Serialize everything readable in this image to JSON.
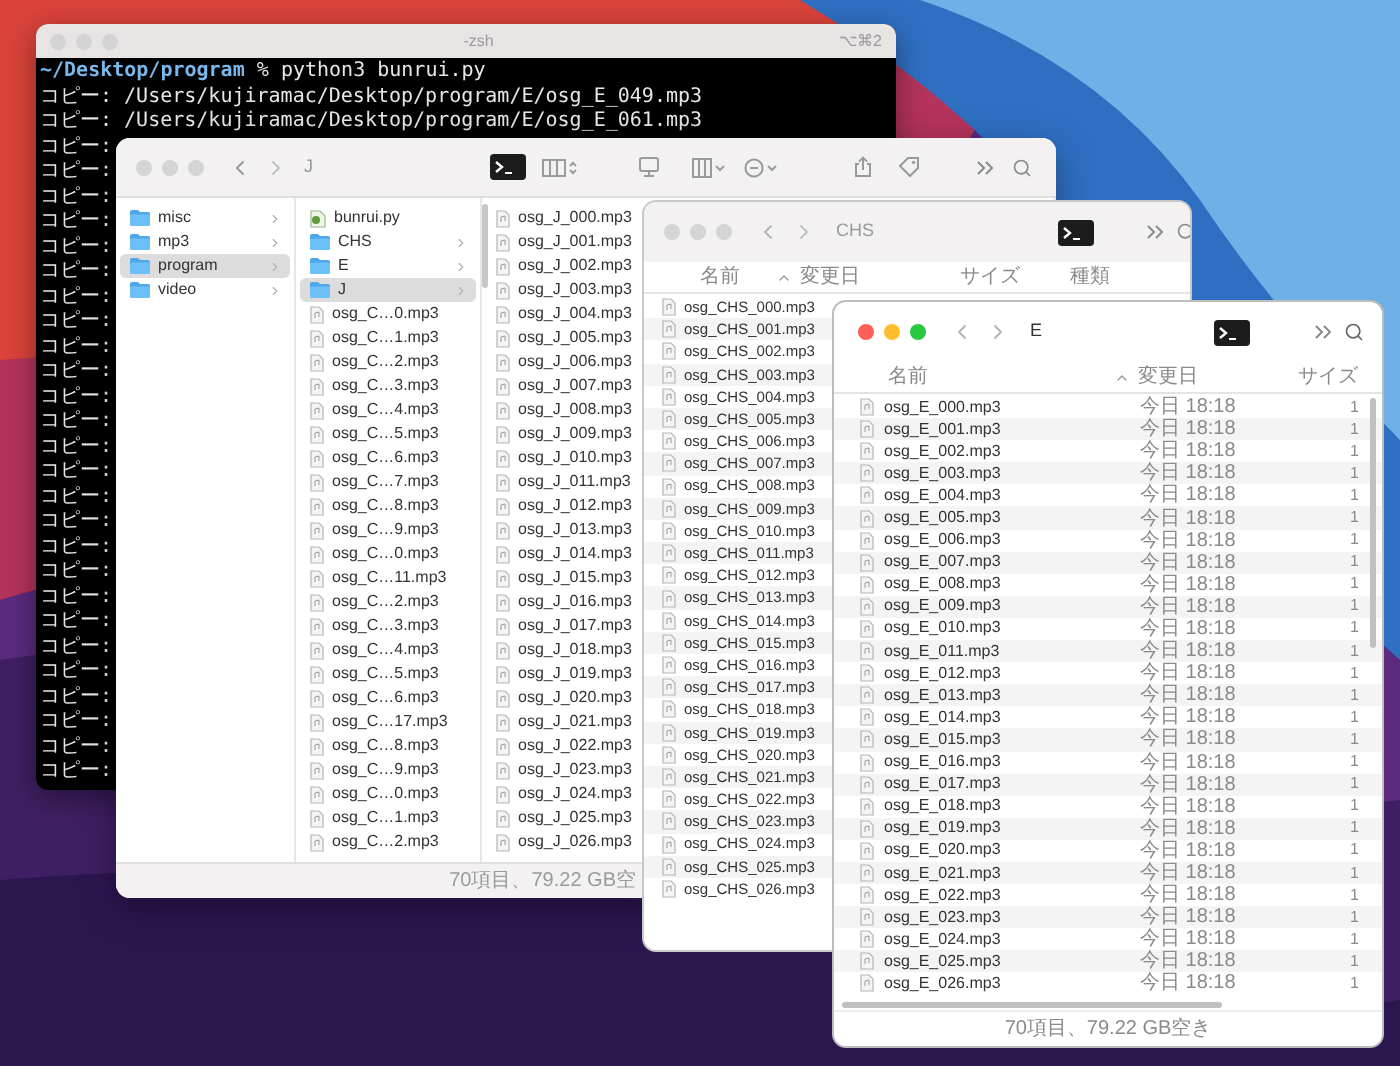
{
  "terminal": {
    "active": false,
    "title": "-zsh",
    "shortcut": "⌥⌘2",
    "prompt": {
      "path": "~/Desktop/program",
      "symbol": "%",
      "command": "python3 bunrui.py"
    },
    "lines": [
      "コピー: /Users/kujiramac/Desktop/program/E/osg_E_049.mp3",
      "コピー: /Users/kujiramac/Desktop/program/E/osg_E_061.mp3",
      "コピー:",
      "コピー:",
      "コピー:",
      "コピー:",
      "コピー:",
      "コピー:",
      "コピー:",
      "コピー:",
      "コピー:",
      "コピー:",
      "コピー:",
      "コピー:",
      "コピー:",
      "コピー:",
      "コピー:",
      "コピー:",
      "コピー:",
      "コピー:",
      "コピー:",
      "コピー:",
      "コピー:",
      "コピー:",
      "コピー:",
      "コピー:",
      "コピー:",
      "コピー:"
    ]
  },
  "finder_j": {
    "active": false,
    "title": "J",
    "columns": [
      {
        "items": [
          {
            "name": "misc",
            "kind": "folder",
            "selected": false
          },
          {
            "name": "mp3",
            "kind": "folder",
            "selected": false
          },
          {
            "name": "program",
            "kind": "folder",
            "selected": true
          },
          {
            "name": "video",
            "kind": "folder",
            "selected": false
          }
        ]
      },
      {
        "items": [
          {
            "name": "bunrui.py",
            "kind": "script",
            "selected": false
          },
          {
            "name": "CHS",
            "kind": "folder",
            "selected": false
          },
          {
            "name": "E",
            "kind": "folder",
            "selected": false
          },
          {
            "name": "J",
            "kind": "folder",
            "selected": true
          },
          {
            "name": "osg_C…0.mp3",
            "kind": "file",
            "selected": false
          },
          {
            "name": "osg_C…1.mp3",
            "kind": "file",
            "selected": false
          },
          {
            "name": "osg_C…2.mp3",
            "kind": "file",
            "selected": false
          },
          {
            "name": "osg_C…3.mp3",
            "kind": "file",
            "selected": false
          },
          {
            "name": "osg_C…4.mp3",
            "kind": "file",
            "selected": false
          },
          {
            "name": "osg_C…5.mp3",
            "kind": "file",
            "selected": false
          },
          {
            "name": "osg_C…6.mp3",
            "kind": "file",
            "selected": false
          },
          {
            "name": "osg_C…7.mp3",
            "kind": "file",
            "selected": false
          },
          {
            "name": "osg_C…8.mp3",
            "kind": "file",
            "selected": false
          },
          {
            "name": "osg_C…9.mp3",
            "kind": "file",
            "selected": false
          },
          {
            "name": "osg_C…0.mp3",
            "kind": "file",
            "selected": false
          },
          {
            "name": "osg_C…11.mp3",
            "kind": "file",
            "selected": false
          },
          {
            "name": "osg_C…2.mp3",
            "kind": "file",
            "selected": false
          },
          {
            "name": "osg_C…3.mp3",
            "kind": "file",
            "selected": false
          },
          {
            "name": "osg_C…4.mp3",
            "kind": "file",
            "selected": false
          },
          {
            "name": "osg_C…5.mp3",
            "kind": "file",
            "selected": false
          },
          {
            "name": "osg_C…6.mp3",
            "kind": "file",
            "selected": false
          },
          {
            "name": "osg_C…17.mp3",
            "kind": "file",
            "selected": false
          },
          {
            "name": "osg_C…8.mp3",
            "kind": "file",
            "selected": false
          },
          {
            "name": "osg_C…9.mp3",
            "kind": "file",
            "selected": false
          },
          {
            "name": "osg_C…0.mp3",
            "kind": "file",
            "selected": false
          },
          {
            "name": "osg_C…1.mp3",
            "kind": "file",
            "selected": false
          },
          {
            "name": "osg_C…2.mp3",
            "kind": "file",
            "selected": false
          }
        ]
      },
      {
        "items": [
          {
            "name": "osg_J_000.mp3",
            "kind": "file",
            "selected": false
          },
          {
            "name": "osg_J_001.mp3",
            "kind": "file",
            "selected": false
          },
          {
            "name": "osg_J_002.mp3",
            "kind": "file",
            "selected": false
          },
          {
            "name": "osg_J_003.mp3",
            "kind": "file",
            "selected": false
          },
          {
            "name": "osg_J_004.mp3",
            "kind": "file",
            "selected": false
          },
          {
            "name": "osg_J_005.mp3",
            "kind": "file",
            "selected": false
          },
          {
            "name": "osg_J_006.mp3",
            "kind": "file",
            "selected": false
          },
          {
            "name": "osg_J_007.mp3",
            "kind": "file",
            "selected": false
          },
          {
            "name": "osg_J_008.mp3",
            "kind": "file",
            "selected": false
          },
          {
            "name": "osg_J_009.mp3",
            "kind": "file",
            "selected": false
          },
          {
            "name": "osg_J_010.mp3",
            "kind": "file",
            "selected": false
          },
          {
            "name": "osg_J_011.mp3",
            "kind": "file",
            "selected": false
          },
          {
            "name": "osg_J_012.mp3",
            "kind": "file",
            "selected": false
          },
          {
            "name": "osg_J_013.mp3",
            "kind": "file",
            "selected": false
          },
          {
            "name": "osg_J_014.mp3",
            "kind": "file",
            "selected": false
          },
          {
            "name": "osg_J_015.mp3",
            "kind": "file",
            "selected": false
          },
          {
            "name": "osg_J_016.mp3",
            "kind": "file",
            "selected": false
          },
          {
            "name": "osg_J_017.mp3",
            "kind": "file",
            "selected": false
          },
          {
            "name": "osg_J_018.mp3",
            "kind": "file",
            "selected": false
          },
          {
            "name": "osg_J_019.mp3",
            "kind": "file",
            "selected": false
          },
          {
            "name": "osg_J_020.mp3",
            "kind": "file",
            "selected": false
          },
          {
            "name": "osg_J_021.mp3",
            "kind": "file",
            "selected": false
          },
          {
            "name": "osg_J_022.mp3",
            "kind": "file",
            "selected": false
          },
          {
            "name": "osg_J_023.mp3",
            "kind": "file",
            "selected": false
          },
          {
            "name": "osg_J_024.mp3",
            "kind": "file",
            "selected": false
          },
          {
            "name": "osg_J_025.mp3",
            "kind": "file",
            "selected": false
          },
          {
            "name": "osg_J_026.mp3",
            "kind": "file",
            "selected": false
          }
        ]
      }
    ],
    "status": "70項目、79.22 GB空"
  },
  "finder_chs": {
    "active": false,
    "title": "CHS",
    "headers": [
      "名前",
      "変更日",
      "サイズ",
      "種類"
    ],
    "files": [
      "osg_CHS_000.mp3",
      "osg_CHS_001.mp3",
      "osg_CHS_002.mp3",
      "osg_CHS_003.mp3",
      "osg_CHS_004.mp3",
      "osg_CHS_005.mp3",
      "osg_CHS_006.mp3",
      "osg_CHS_007.mp3",
      "osg_CHS_008.mp3",
      "osg_CHS_009.mp3",
      "osg_CHS_010.mp3",
      "osg_CHS_011.mp3",
      "osg_CHS_012.mp3",
      "osg_CHS_013.mp3",
      "osg_CHS_014.mp3",
      "osg_CHS_015.mp3",
      "osg_CHS_016.mp3",
      "osg_CHS_017.mp3",
      "osg_CHS_018.mp3",
      "osg_CHS_019.mp3",
      "osg_CHS_020.mp3",
      "osg_CHS_021.mp3",
      "osg_CHS_022.mp3",
      "osg_CHS_023.mp3",
      "osg_CHS_024.mp3",
      "osg_CHS_025.mp3",
      "osg_CHS_026.mp3"
    ]
  },
  "finder_e": {
    "active": true,
    "title": "E",
    "headers": [
      "名前",
      "変更日",
      "サイズ"
    ],
    "files": [
      {
        "name": "osg_E_000.mp3",
        "modified": "今日 18:18",
        "size": "1"
      },
      {
        "name": "osg_E_001.mp3",
        "modified": "今日 18:18",
        "size": "1"
      },
      {
        "name": "osg_E_002.mp3",
        "modified": "今日 18:18",
        "size": "1"
      },
      {
        "name": "osg_E_003.mp3",
        "modified": "今日 18:18",
        "size": "1"
      },
      {
        "name": "osg_E_004.mp3",
        "modified": "今日 18:18",
        "size": "1"
      },
      {
        "name": "osg_E_005.mp3",
        "modified": "今日 18:18",
        "size": "1"
      },
      {
        "name": "osg_E_006.mp3",
        "modified": "今日 18:18",
        "size": "1"
      },
      {
        "name": "osg_E_007.mp3",
        "modified": "今日 18:18",
        "size": "1"
      },
      {
        "name": "osg_E_008.mp3",
        "modified": "今日 18:18",
        "size": "1"
      },
      {
        "name": "osg_E_009.mp3",
        "modified": "今日 18:18",
        "size": "1"
      },
      {
        "name": "osg_E_010.mp3",
        "modified": "今日 18:18",
        "size": "1"
      },
      {
        "name": "osg_E_011.mp3",
        "modified": "今日 18:18",
        "size": "1"
      },
      {
        "name": "osg_E_012.mp3",
        "modified": "今日 18:18",
        "size": "1"
      },
      {
        "name": "osg_E_013.mp3",
        "modified": "今日 18:18",
        "size": "1"
      },
      {
        "name": "osg_E_014.mp3",
        "modified": "今日 18:18",
        "size": "1"
      },
      {
        "name": "osg_E_015.mp3",
        "modified": "今日 18:18",
        "size": "1"
      },
      {
        "name": "osg_E_016.mp3",
        "modified": "今日 18:18",
        "size": "1"
      },
      {
        "name": "osg_E_017.mp3",
        "modified": "今日 18:18",
        "size": "1"
      },
      {
        "name": "osg_E_018.mp3",
        "modified": "今日 18:18",
        "size": "1"
      },
      {
        "name": "osg_E_019.mp3",
        "modified": "今日 18:18",
        "size": "1"
      },
      {
        "name": "osg_E_020.mp3",
        "modified": "今日 18:18",
        "size": "1"
      },
      {
        "name": "osg_E_021.mp3",
        "modified": "今日 18:18",
        "size": "1"
      },
      {
        "name": "osg_E_022.mp3",
        "modified": "今日 18:18",
        "size": "1"
      },
      {
        "name": "osg_E_023.mp3",
        "modified": "今日 18:18",
        "size": "1"
      },
      {
        "name": "osg_E_024.mp3",
        "modified": "今日 18:18",
        "size": "1"
      },
      {
        "name": "osg_E_025.mp3",
        "modified": "今日 18:18",
        "size": "1"
      },
      {
        "name": "osg_E_026.mp3",
        "modified": "今日 18:18",
        "size": "1"
      }
    ],
    "status": "70項目、79.22 GB空き"
  }
}
